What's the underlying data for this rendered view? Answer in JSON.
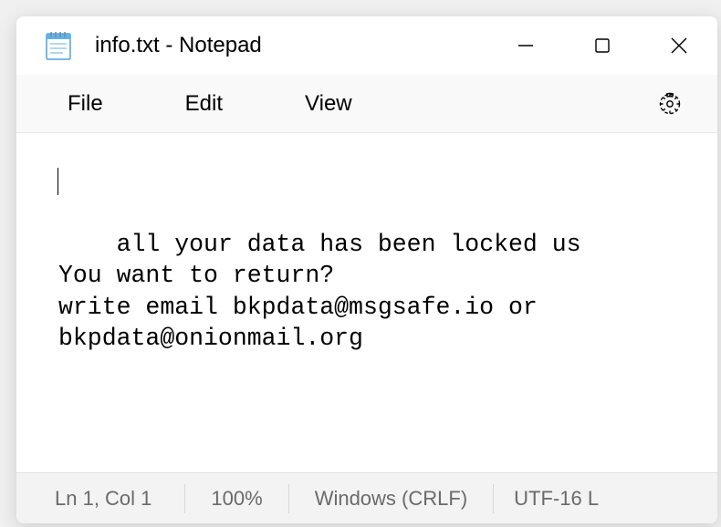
{
  "titlebar": {
    "title": "info.txt - Notepad"
  },
  "menubar": {
    "file": "File",
    "edit": "Edit",
    "view": "View"
  },
  "editor": {
    "content": "all your data has been locked us\nYou want to return?\nwrite email bkpdata@msgsafe.io or bkpdata@onionmail.org"
  },
  "statusbar": {
    "position": "Ln 1, Col 1",
    "zoom": "100%",
    "eol": "Windows (CRLF)",
    "encoding": "UTF-16 L"
  }
}
